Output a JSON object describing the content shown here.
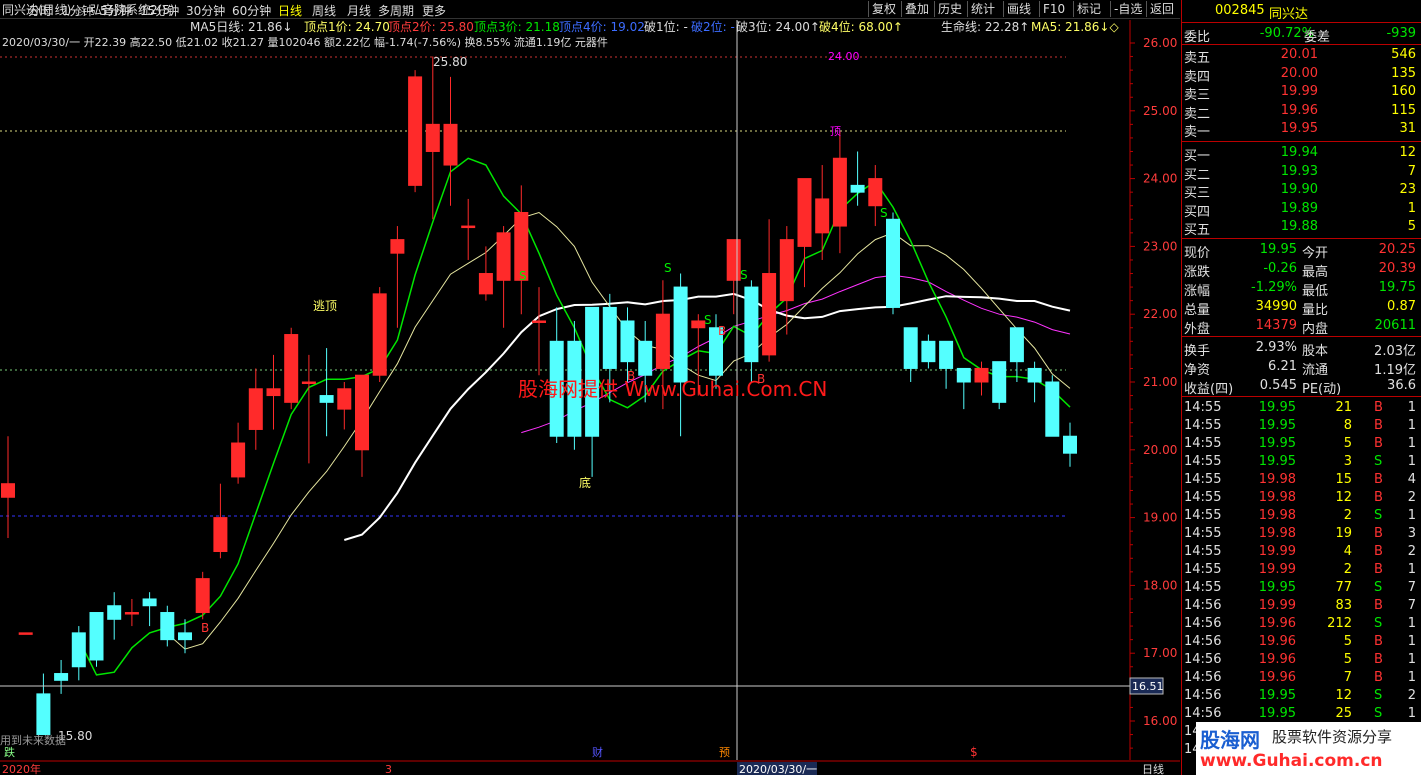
{
  "window": {
    "title": "同兴达(日线)",
    "system": "弘音院系统2(5)"
  },
  "tabs": [
    "分时",
    "1分钟",
    "5分钟",
    "15分钟",
    "30分钟",
    "60分钟",
    "日线",
    "周线",
    "月线",
    "多周期",
    "更多"
  ],
  "active_tab": "日线",
  "toolbar": [
    "复权",
    "叠加",
    "历史",
    "统计",
    "画线",
    "F10",
    "标记",
    "-自选",
    "返回"
  ],
  "legend": {
    "ma5_label": "MA5日线: 21.86↓",
    "ding1": "顶点1价: 24.70",
    "ding2": "顶点2价: 25.80",
    "ding3": "顶点3价: 21.18",
    "ding4": "顶点4价: 19.02",
    "po1": "破1位: -",
    "po2": "破2位: -",
    "po3": "破3位: 24.00↑",
    "po4": "破4位: 68.00↑",
    "life": "生命线: 22.28↑",
    "ma5": "MA5: 21.86↓◇"
  },
  "info_line": "2020/03/30/一 开22.39 高22.50 低21.02 收21.27 量102046 额2.22亿 幅-1.74(-7.56%) 换8.55% 流通1.19亿 元器件",
  "chart_labels": {
    "escape": "逃顶",
    "bottom": "底",
    "high_label": "25.80",
    "low_label": "15.80",
    "watermark": "股海网提供 Www.Guhai.Com.CN",
    "future_note": "用到未来数据",
    "ding_mark": "顶",
    "cursor_price": "16.51",
    "x_year": "2020年",
    "x_mar": "3",
    "x_cursor_date": "2020/03/30/一",
    "period_label": "日线",
    "mark_die": "跌",
    "mark_cai": "财",
    "mark_yu": "预",
    "mark_dollar": "$",
    "top_partial": "24.00"
  },
  "chart_data": {
    "type": "candlestick",
    "y_ticks": [
      26.0,
      25.0,
      24.0,
      23.0,
      22.0,
      21.0,
      20.0,
      19.0,
      18.0,
      17.0,
      16.0
    ],
    "ylim": [
      15.7,
      26.3
    ],
    "candles": [
      {
        "o": 19.3,
        "c": 19.5,
        "h": 20.2,
        "l": 18.7
      },
      {
        "o": 17.3,
        "c": 17.3,
        "h": 17.3,
        "l": 17.3
      },
      {
        "o": 16.4,
        "c": 15.8,
        "h": 16.7,
        "l": 15.8
      },
      {
        "o": 16.7,
        "c": 16.6,
        "h": 16.9,
        "l": 16.4
      },
      {
        "o": 17.3,
        "c": 16.8,
        "h": 17.4,
        "l": 16.6
      },
      {
        "o": 17.6,
        "c": 16.9,
        "h": 17.6,
        "l": 16.8
      },
      {
        "o": 17.7,
        "c": 17.5,
        "h": 17.9,
        "l": 17.2
      },
      {
        "o": 17.6,
        "c": 17.6,
        "h": 17.8,
        "l": 17.4
      },
      {
        "o": 17.8,
        "c": 17.7,
        "h": 17.9,
        "l": 17.4
      },
      {
        "o": 17.6,
        "c": 17.2,
        "h": 17.7,
        "l": 17.1
      },
      {
        "o": 17.3,
        "c": 17.2,
        "h": 17.5,
        "l": 17.0
      },
      {
        "o": 17.6,
        "c": 18.1,
        "h": 18.2,
        "l": 17.5
      },
      {
        "o": 18.5,
        "c": 19.0,
        "h": 19.5,
        "l": 18.4
      },
      {
        "o": 19.6,
        "c": 20.1,
        "h": 20.4,
        "l": 19.5
      },
      {
        "o": 20.3,
        "c": 20.9,
        "h": 21.2,
        "l": 20.0
      },
      {
        "o": 20.8,
        "c": 20.9,
        "h": 21.4,
        "l": 20.3
      },
      {
        "o": 20.7,
        "c": 21.7,
        "h": 21.8,
        "l": 20.6
      },
      {
        "o": 21.0,
        "c": 21.0,
        "h": 21.4,
        "l": 19.8
      },
      {
        "o": 20.8,
        "c": 20.7,
        "h": 21.5,
        "l": 20.2
      },
      {
        "o": 20.6,
        "c": 20.9,
        "h": 21.0,
        "l": 20.3
      },
      {
        "o": 20.0,
        "c": 21.1,
        "h": 21.1,
        "l": 19.6
      },
      {
        "o": 21.1,
        "c": 22.3,
        "h": 22.4,
        "l": 21.0
      },
      {
        "o": 22.9,
        "c": 23.1,
        "h": 23.3,
        "l": 21.8
      },
      {
        "o": 23.9,
        "c": 25.5,
        "h": 25.6,
        "l": 23.8
      },
      {
        "o": 24.4,
        "c": 24.8,
        "h": 25.8,
        "l": 23.4
      },
      {
        "o": 24.2,
        "c": 24.8,
        "h": 25.5,
        "l": 23.6
      },
      {
        "o": 23.3,
        "c": 23.3,
        "h": 23.7,
        "l": 22.8
      },
      {
        "o": 22.3,
        "c": 22.6,
        "h": 23.0,
        "l": 22.2
      },
      {
        "o": 22.5,
        "c": 23.2,
        "h": 23.3,
        "l": 21.8
      },
      {
        "o": 22.5,
        "c": 23.5,
        "h": 23.9,
        "l": 22.0
      },
      {
        "o": 21.9,
        "c": 21.9,
        "h": 22.4,
        "l": 21.1
      },
      {
        "o": 21.6,
        "c": 20.2,
        "h": 22.1,
        "l": 20.1
      },
      {
        "o": 21.6,
        "c": 20.2,
        "h": 21.9,
        "l": 20.0
      },
      {
        "o": 22.1,
        "c": 20.2,
        "h": 22.1,
        "l": 19.6
      },
      {
        "o": 22.1,
        "c": 21.2,
        "h": 22.3,
        "l": 20.7
      },
      {
        "o": 21.9,
        "c": 21.3,
        "h": 22.1,
        "l": 21.0
      },
      {
        "o": 21.6,
        "c": 21.1,
        "h": 21.9,
        "l": 20.7
      },
      {
        "o": 21.2,
        "c": 22.0,
        "h": 22.5,
        "l": 20.6
      },
      {
        "o": 22.4,
        "c": 21.0,
        "h": 22.6,
        "l": 20.2
      },
      {
        "o": 21.8,
        "c": 21.9,
        "h": 22.0,
        "l": 20.8
      },
      {
        "o": 21.8,
        "c": 21.1,
        "h": 22.0,
        "l": 20.9
      },
      {
        "o": 22.5,
        "c": 23.1,
        "h": 23.1,
        "l": 22.0
      },
      {
        "o": 22.4,
        "c": 21.3,
        "h": 22.5,
        "l": 21.0
      },
      {
        "o": 21.4,
        "c": 22.6,
        "h": 23.4,
        "l": 21.3
      },
      {
        "o": 22.2,
        "c": 23.1,
        "h": 23.3,
        "l": 21.7
      },
      {
        "o": 23.0,
        "c": 24.0,
        "h": 24.0,
        "l": 22.4
      },
      {
        "o": 23.2,
        "c": 23.7,
        "h": 24.2,
        "l": 22.8
      },
      {
        "o": 23.3,
        "c": 24.3,
        "h": 24.7,
        "l": 22.9
      },
      {
        "o": 23.9,
        "c": 23.8,
        "h": 24.4,
        "l": 23.6
      },
      {
        "o": 23.6,
        "c": 24.0,
        "h": 24.2,
        "l": 23.3
      },
      {
        "o": 23.4,
        "c": 22.1,
        "h": 23.5,
        "l": 22.0
      },
      {
        "o": 21.8,
        "c": 21.2,
        "h": 21.8,
        "l": 21.0
      },
      {
        "o": 21.6,
        "c": 21.3,
        "h": 21.7,
        "l": 21.2
      },
      {
        "o": 21.6,
        "c": 21.2,
        "h": 21.6,
        "l": 20.9
      },
      {
        "o": 21.2,
        "c": 21.0,
        "h": 21.2,
        "l": 20.6
      },
      {
        "o": 21.0,
        "c": 21.2,
        "h": 21.3,
        "l": 20.8
      },
      {
        "o": 21.3,
        "c": 20.7,
        "h": 21.3,
        "l": 20.6
      },
      {
        "o": 21.8,
        "c": 21.3,
        "h": 21.8,
        "l": 21.0
      },
      {
        "o": 21.2,
        "c": 21.0,
        "h": 21.3,
        "l": 20.7
      },
      {
        "o": 21.0,
        "c": 20.2,
        "h": 21.1,
        "l": 20.2
      },
      {
        "o": 20.2,
        "c": 19.95,
        "h": 20.4,
        "l": 19.75
      }
    ]
  },
  "quote": {
    "code": "002845",
    "name": "同兴达",
    "weibi_label": "委比",
    "weibi_val": "-90.72%",
    "weicha_label": "委差",
    "weicha_val": "-939",
    "asks": [
      {
        "label": "卖五",
        "price": "20.01",
        "vol": "546"
      },
      {
        "label": "卖四",
        "price": "20.00",
        "vol": "135"
      },
      {
        "label": "卖三",
        "price": "19.99",
        "vol": "160"
      },
      {
        "label": "卖二",
        "price": "19.96",
        "vol": "115"
      },
      {
        "label": "卖一",
        "price": "19.95",
        "vol": "31"
      }
    ],
    "bids": [
      {
        "label": "买一",
        "price": "19.94",
        "vol": "12"
      },
      {
        "label": "买二",
        "price": "19.93",
        "vol": "7"
      },
      {
        "label": "买三",
        "price": "19.90",
        "vol": "23"
      },
      {
        "label": "买四",
        "price": "19.89",
        "vol": "1"
      },
      {
        "label": "买五",
        "price": "19.88",
        "vol": "5"
      }
    ],
    "stats": [
      {
        "l1": "现价",
        "v1": "19.95",
        "c1": "green",
        "l2": "今开",
        "v2": "20.25",
        "c2": "red"
      },
      {
        "l1": "涨跌",
        "v1": "-0.26",
        "c1": "green",
        "l2": "最高",
        "v2": "20.39",
        "c2": "red"
      },
      {
        "l1": "涨幅",
        "v1": "-1.29%",
        "c1": "green",
        "l2": "最低",
        "v2": "19.75",
        "c2": "green"
      },
      {
        "l1": "总量",
        "v1": "34990",
        "c1": "yellow",
        "l2": "量比",
        "v2": "0.87",
        "c2": "yellow"
      },
      {
        "l1": "外盘",
        "v1": "14379",
        "c1": "red",
        "l2": "内盘",
        "v2": "20611",
        "c2": "green"
      }
    ],
    "stats2": [
      {
        "l1": "换手",
        "v1": "2.93%",
        "l2": "股本",
        "v2": "2.03亿"
      },
      {
        "l1": "净资",
        "v1": "6.21",
        "l2": "流通",
        "v2": "1.19亿"
      },
      {
        "l1": "收益(四)",
        "v1": "0.545",
        "l2": "PE(动)",
        "v2": "36.6"
      }
    ],
    "ticks": [
      {
        "t": "14:55",
        "p": "19.95",
        "v": "21",
        "s": "B",
        "n": "1"
      },
      {
        "t": "14:55",
        "p": "19.95",
        "v": "8",
        "s": "B",
        "n": "1"
      },
      {
        "t": "14:55",
        "p": "19.95",
        "v": "5",
        "s": "B",
        "n": "1"
      },
      {
        "t": "14:55",
        "p": "19.95",
        "v": "3",
        "s": "S",
        "n": "1"
      },
      {
        "t": "14:55",
        "p": "19.98",
        "v": "15",
        "s": "B",
        "n": "4"
      },
      {
        "t": "14:55",
        "p": "19.98",
        "v": "12",
        "s": "B",
        "n": "2"
      },
      {
        "t": "14:55",
        "p": "19.98",
        "v": "2",
        "s": "S",
        "n": "1"
      },
      {
        "t": "14:55",
        "p": "19.98",
        "v": "19",
        "s": "B",
        "n": "3"
      },
      {
        "t": "14:55",
        "p": "19.99",
        "v": "4",
        "s": "B",
        "n": "2"
      },
      {
        "t": "14:55",
        "p": "19.99",
        "v": "2",
        "s": "B",
        "n": "1"
      },
      {
        "t": "14:55",
        "p": "19.95",
        "v": "77",
        "s": "S",
        "n": "7"
      },
      {
        "t": "14:56",
        "p": "19.99",
        "v": "83",
        "s": "B",
        "n": "7"
      },
      {
        "t": "14:56",
        "p": "19.96",
        "v": "212",
        "s": "S",
        "n": "1"
      },
      {
        "t": "14:56",
        "p": "19.96",
        "v": "5",
        "s": "B",
        "n": "1"
      },
      {
        "t": "14:56",
        "p": "19.96",
        "v": "5",
        "s": "B",
        "n": "1"
      },
      {
        "t": "14:56",
        "p": "19.96",
        "v": "7",
        "s": "B",
        "n": "1"
      },
      {
        "t": "14:56",
        "p": "19.95",
        "v": "12",
        "s": "S",
        "n": "2"
      },
      {
        "t": "14:56",
        "p": "19.95",
        "v": "25",
        "s": "S",
        "n": "1"
      }
    ],
    "ticks_partial": [
      "14:5",
      "14:5"
    ],
    "watermark_logo": "股海网",
    "watermark_slogan": "股票软件资源分享",
    "watermark_url": "www.Guhai.com.cn"
  }
}
